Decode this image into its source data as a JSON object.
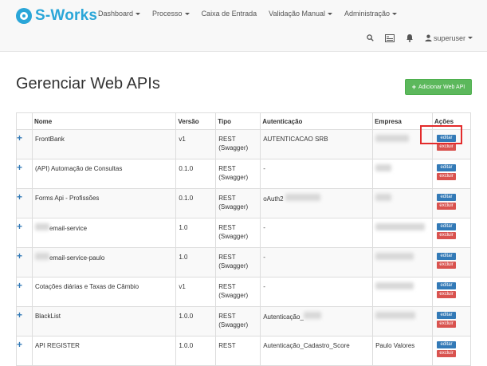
{
  "brand": {
    "name": "S-Works"
  },
  "nav": [
    {
      "label": "Dashboard",
      "dropdown": true
    },
    {
      "label": "Processo",
      "dropdown": true
    },
    {
      "label": "Caixa de Entrada",
      "dropdown": false
    },
    {
      "label": "Validação Manual",
      "dropdown": true
    },
    {
      "label": "Administração",
      "dropdown": true
    }
  ],
  "user": {
    "name": "superuser"
  },
  "page": {
    "title": "Gerenciar Web APIs",
    "add_button": "Adicionar Web API"
  },
  "table": {
    "headers": [
      "Nome",
      "Versão",
      "Tipo",
      "Autenticação",
      "Empresa",
      "Ações"
    ],
    "rows": [
      {
        "name": "FrontBank",
        "version": "v1",
        "type": "REST (Swagger)",
        "auth": "AUTENTICACAO SRB",
        "company": ""
      },
      {
        "name": "(API) Automação de Consultas",
        "version": "0.1.0",
        "type": "REST (Swagger)",
        "auth": "-",
        "company": ""
      },
      {
        "name": "Forms Api - Profissões",
        "version": "0.1.0",
        "type": "REST (Swagger)",
        "auth": "oAuth2",
        "company": ""
      },
      {
        "name": "email-service",
        "version": "1.0",
        "type": "REST (Swagger)",
        "auth": "-",
        "company": ""
      },
      {
        "name": "email-service-paulo",
        "version": "1.0",
        "type": "REST (Swagger)",
        "auth": "-",
        "company": ""
      },
      {
        "name": "Cotações diárias e Taxas de Câmbio",
        "version": "v1",
        "type": "REST (Swagger)",
        "auth": "-",
        "company": ""
      },
      {
        "name": "BlackList",
        "version": "1.0.0",
        "type": "REST (Swagger)",
        "auth": "Autenticação_",
        "company": ""
      },
      {
        "name": "API REGISTER",
        "version": "1.0.0",
        "type": "REST",
        "auth": "Autenticação_Cadastro_Score",
        "company": "Paulo Valores"
      }
    ],
    "edit_label": "editar",
    "delete_label": "excluir"
  }
}
